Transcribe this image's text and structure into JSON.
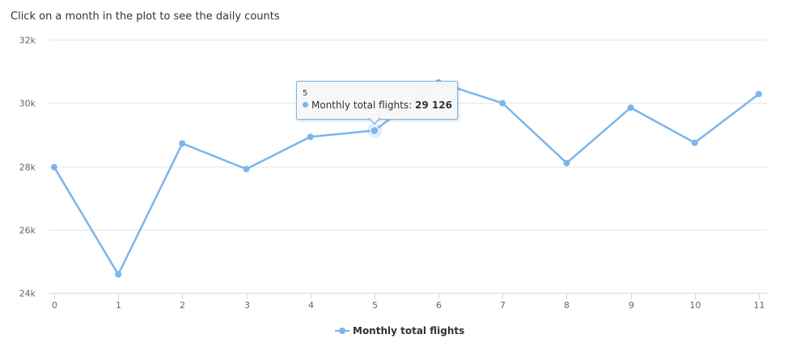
{
  "subtitle": "Click on a month in the plot to see the daily counts",
  "tooltip": {
    "header": "5",
    "series_label": "Monthly total flights: ",
    "value": "29 126"
  },
  "legend": {
    "label": "Monthly total flights"
  },
  "colors": {
    "series": "#7cb5ec",
    "grid": "#e6e6e6",
    "axis": "#ccd6eb"
  },
  "chart_data": {
    "type": "line",
    "title": "",
    "xlabel": "",
    "ylabel": "",
    "x": [
      0,
      1,
      2,
      3,
      4,
      5,
      6,
      7,
      8,
      9,
      10,
      11
    ],
    "series": [
      {
        "name": "Monthly total flights",
        "values": [
          27970,
          24580,
          28720,
          27910,
          28930,
          29126,
          30650,
          29990,
          28100,
          29850,
          28740,
          30280
        ]
      }
    ],
    "xticks": [
      "0",
      "1",
      "2",
      "3",
      "4",
      "5",
      "6",
      "7",
      "8",
      "9",
      "10",
      "11"
    ],
    "yticks": [
      "24k",
      "26k",
      "28k",
      "30k",
      "32k"
    ],
    "ylim": [
      24000,
      32000
    ],
    "grid": true,
    "legend_position": "bottom-center",
    "highlighted_index": 5
  }
}
